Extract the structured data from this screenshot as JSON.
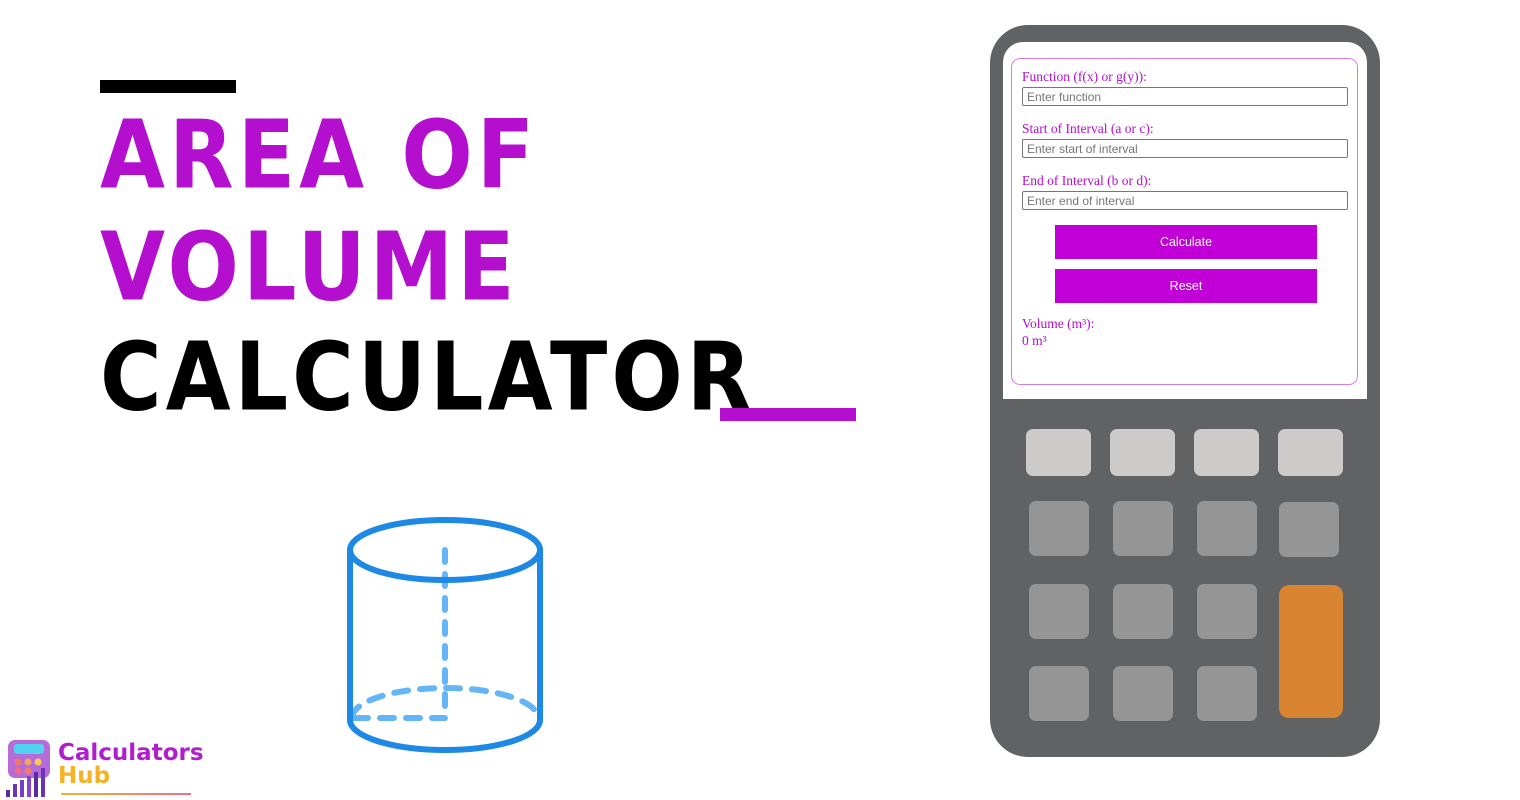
{
  "title": {
    "line1": "Area of",
    "line2": "Volume",
    "line3": "Calculator"
  },
  "colors": {
    "accent": "#b40ecf",
    "button": "#c000d6",
    "calculator_body": "#616263",
    "key_light": "#cccbc9",
    "key_dark": "#959595",
    "key_orange": "#d98430",
    "cylinder": "#1e88e5"
  },
  "form": {
    "function_label": "Function (f(x) or g(y)):",
    "function_placeholder": "Enter function",
    "function_value": "",
    "start_label": "Start of Interval (a or c):",
    "start_placeholder": "Enter start of interval",
    "start_value": "",
    "end_label": "End of Interval (b or d):",
    "end_placeholder": "Enter end of interval",
    "end_value": "",
    "calculate_label": "Calculate",
    "reset_label": "Reset",
    "result_label": "Volume (m³):",
    "result_value": "0 m³"
  },
  "logo": {
    "line1": "Calculators",
    "line2": "Hub",
    "icon": "calculator-chart-icon"
  },
  "illustration": {
    "icon": "cylinder-icon"
  }
}
